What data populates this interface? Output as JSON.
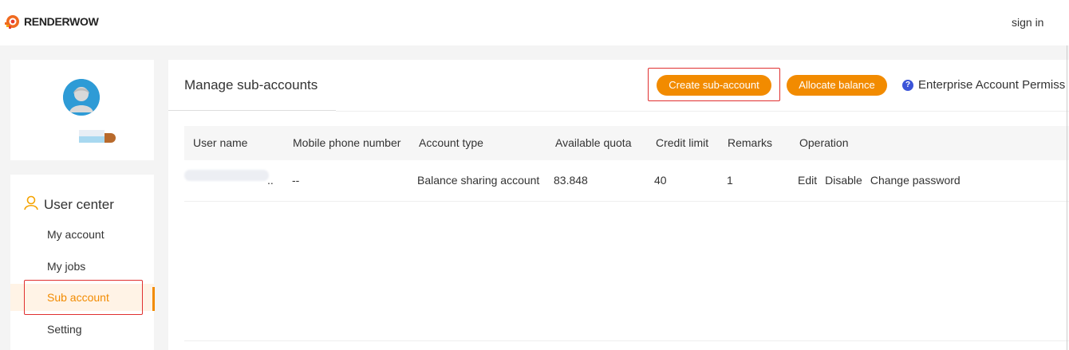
{
  "header": {
    "brand": "RENDERWOW",
    "sign_in": "sign in"
  },
  "sidebar": {
    "section_title": "User center",
    "items": [
      {
        "label": "My account"
      },
      {
        "label": "My jobs"
      },
      {
        "label": "Sub account",
        "active": true
      },
      {
        "label": "Setting"
      }
    ]
  },
  "main": {
    "title": "Manage sub-accounts",
    "create_button": "Create sub-account",
    "allocate_button": "Allocate balance",
    "permission_link": "Enterprise Account Permiss",
    "table": {
      "columns": [
        "User name",
        "Mobile phone number",
        "Account type",
        "Available quota",
        "Credit limit",
        "Remarks",
        "Operation"
      ],
      "rows": [
        {
          "user_name": "..",
          "mobile": "--",
          "account_type": "Balance sharing account",
          "available_quota": "83.848",
          "credit_limit": "40",
          "remarks": "1",
          "operations": [
            "Edit",
            "Disable",
            "Change password"
          ]
        }
      ]
    }
  },
  "colors": {
    "accent": "#f28b00",
    "highlight_box": "#e03030",
    "help_icon": "#3b54d8"
  },
  "icons": {
    "logo": "renderwow-logo-icon",
    "avatar": "user-avatar-icon",
    "user_center": "user-outline-icon",
    "help": "question-circle-icon"
  }
}
